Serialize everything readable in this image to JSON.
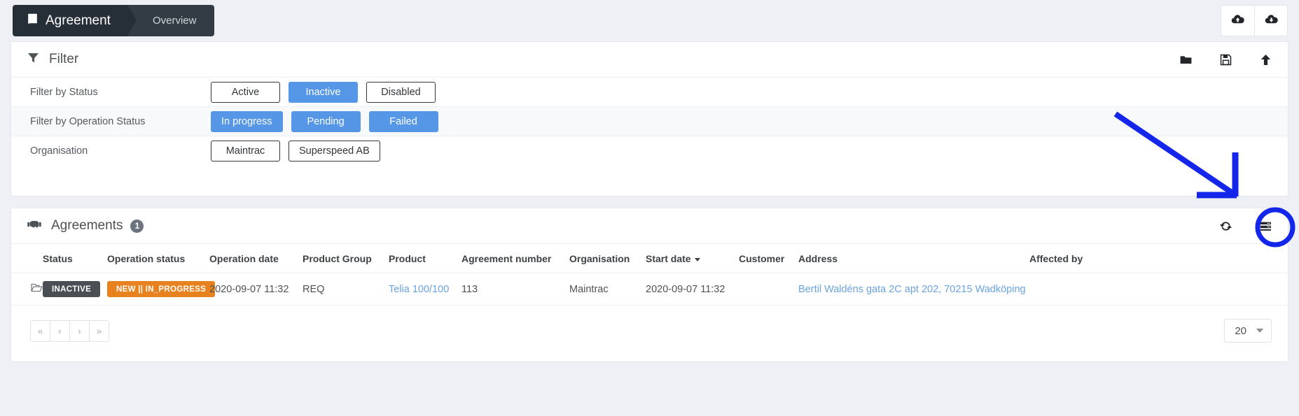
{
  "breadcrumb": {
    "icon": "book-icon",
    "main_label": "Agreement",
    "sub_label": "Overview"
  },
  "topbar": {
    "actions": [
      {
        "name": "cloud-upload-icon",
        "label": "Cloud upload"
      },
      {
        "name": "cloud-download-icon",
        "label": "Cloud download"
      }
    ]
  },
  "filter_panel": {
    "icon": "filter-icon",
    "title": "Filter",
    "head_icons": [
      {
        "name": "folder-icon",
        "label": "Open saved filter"
      },
      {
        "name": "floppy-save-icon",
        "label": "Save filter"
      },
      {
        "name": "arrow-up-icon",
        "label": "Collapse"
      }
    ],
    "rows": [
      {
        "label": "Filter by Status",
        "options": [
          {
            "label": "Active",
            "selected": false
          },
          {
            "label": "Inactive",
            "selected": true
          },
          {
            "label": "Disabled",
            "selected": false
          }
        ]
      },
      {
        "label": "Filter by Operation Status",
        "options": [
          {
            "label": "In progress",
            "selected": true
          },
          {
            "label": "Pending",
            "selected": true
          },
          {
            "label": "Failed",
            "selected": true
          }
        ]
      },
      {
        "label": "Organisation",
        "options": [
          {
            "label": "Maintrac",
            "selected": false
          },
          {
            "label": "Superspeed AB",
            "selected": false
          }
        ]
      }
    ]
  },
  "agreements_panel": {
    "icon": "handshake-icon",
    "title": "Agreements",
    "count": "1",
    "head_icons": [
      {
        "name": "refresh-icon",
        "label": "Refresh"
      },
      {
        "name": "table-settings-icon",
        "label": "Table settings",
        "highlighted": true
      }
    ],
    "columns": [
      "Status",
      "Operation status",
      "Operation date",
      "Product Group",
      "Product",
      "Agreement number",
      "Organisation",
      "Start date",
      "Customer",
      "Address",
      "Affected by"
    ],
    "sorted_column": "Start date",
    "sort_direction": "desc",
    "rows": [
      {
        "row_icon": "open-folder-icon",
        "status": "INACTIVE",
        "operation_status": "NEW || IN_PROGRESS",
        "operation_date": "2020-09-07 11:32",
        "product_group": "REQ",
        "product": "Telia 100/100",
        "agreement_number": "113",
        "organisation": "Maintrac",
        "start_date": "2020-09-07 11:32",
        "customer": "",
        "address": "Bertil Waldéns gata 2C apt 202, 70215 Wadköping",
        "affected_by": ""
      }
    ],
    "pager": {
      "first": "«",
      "prev": "‹",
      "next": "›",
      "last": "»",
      "page_size": "20"
    }
  },
  "annotation": {
    "type": "arrow-and-circle",
    "color": "#1326ea",
    "target": "table-settings-icon"
  },
  "colors": {
    "accent_blue": "#5596e6",
    "badge_dark": "#4a4f54",
    "badge_orange": "#e8821e",
    "link_blue": "#6aa3e0",
    "annotation_blue": "#1326ea"
  }
}
